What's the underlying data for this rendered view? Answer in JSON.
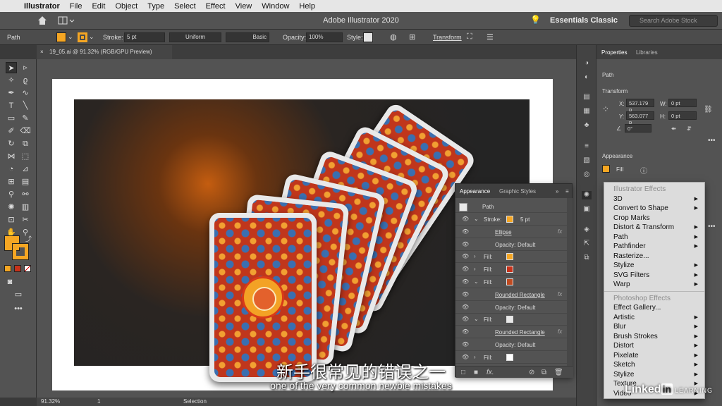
{
  "menubar": {
    "apple_icon": "apple-logo-icon",
    "app_name": "Illustrator",
    "items": [
      "File",
      "Edit",
      "Object",
      "Type",
      "Select",
      "Effect",
      "View",
      "Window",
      "Help"
    ]
  },
  "titlebar": {
    "title": "Adobe Illustrator 2020",
    "workspace": "Essentials Classic",
    "search_placeholder": "Search Adobe Stock"
  },
  "controlbar": {
    "selection_type": "Path",
    "fill_color": "#f5a623",
    "stroke_label": "Stroke:",
    "stroke_weight": "5 pt",
    "profile": "Uniform",
    "brush": "Basic",
    "opacity_label": "Opacity:",
    "opacity": "100%",
    "style_label": "Style:",
    "transform_label": "Transform"
  },
  "document": {
    "tab_title": "19_05.ai @ 91.32% (RGB/GPU Preview)"
  },
  "statusbar": {
    "zoom": "91.32%",
    "artboard": "1",
    "tool": "Selection"
  },
  "properties": {
    "tabs": [
      "Properties",
      "Libraries"
    ],
    "selection": "Path",
    "transform_title": "Transform",
    "x_label": "X:",
    "x": "537.179 p",
    "y_label": "Y:",
    "y": "563.077 p",
    "w_label": "W:",
    "w": "0 pt",
    "h_label": "H:",
    "h": "0 pt",
    "angle": "0°",
    "appearance_title": "Appearance",
    "fill_label": "Fill"
  },
  "appearance": {
    "tabs": [
      "Appearance",
      "Graphic Styles"
    ],
    "object": "Path",
    "rows": [
      {
        "label": "Stroke:",
        "value": "5 pt",
        "swatch": "#f5a623",
        "indent": 0,
        "twirl": "⌄"
      },
      {
        "label": "Ellipse",
        "indent": 1,
        "fx": true
      },
      {
        "label": "Opacity:",
        "value": "Default",
        "indent": 1
      },
      {
        "label": "Fill:",
        "swatch": "#f5a623",
        "indent": 0,
        "twirl": "›"
      },
      {
        "label": "Fill:",
        "swatch": "#c7321a",
        "indent": 0,
        "twirl": "›"
      },
      {
        "label": "Fill:",
        "swatch": "#c04a20",
        "indent": 0,
        "twirl": "⌄"
      },
      {
        "label": "Rounded Rectangle",
        "indent": 1,
        "fx": true
      },
      {
        "label": "Opacity:",
        "value": "Default",
        "indent": 1
      },
      {
        "label": "Fill:",
        "swatch": "#e8e8e8",
        "indent": 0,
        "twirl": "⌄"
      },
      {
        "label": "Rounded Rectangle",
        "indent": 1,
        "fx": true
      },
      {
        "label": "Opacity:",
        "value": "Default",
        "indent": 1
      },
      {
        "label": "Fill:",
        "swatch": "#ffffff",
        "indent": 0,
        "twirl": "›"
      }
    ],
    "fx_icon": "fx"
  },
  "effect_menu": {
    "illustrator_header": "Illustrator Effects",
    "illustrator_items": [
      {
        "label": "3D",
        "submenu": true
      },
      {
        "label": "Convert to Shape",
        "submenu": true
      },
      {
        "label": "Crop Marks",
        "submenu": false
      },
      {
        "label": "Distort & Transform",
        "submenu": true
      },
      {
        "label": "Path",
        "submenu": true
      },
      {
        "label": "Pathfinder",
        "submenu": true
      },
      {
        "label": "Rasterize...",
        "submenu": false
      },
      {
        "label": "Stylize",
        "submenu": true
      },
      {
        "label": "SVG Filters",
        "submenu": true
      },
      {
        "label": "Warp",
        "submenu": true
      }
    ],
    "photoshop_header": "Photoshop Effects",
    "photoshop_items": [
      {
        "label": "Effect Gallery...",
        "submenu": false
      },
      {
        "label": "Artistic",
        "submenu": true
      },
      {
        "label": "Blur",
        "submenu": true
      },
      {
        "label": "Brush Strokes",
        "submenu": true
      },
      {
        "label": "Distort",
        "submenu": true
      },
      {
        "label": "Pixelate",
        "submenu": true
      },
      {
        "label": "Sketch",
        "submenu": true
      },
      {
        "label": "Stylize",
        "submenu": true
      },
      {
        "label": "Texture",
        "submenu": true
      },
      {
        "label": "Video",
        "submenu": true
      }
    ]
  },
  "subtitles": {
    "chinese": "新手很常见的错误之一",
    "english": "one of the very common newbie mistakes"
  },
  "watermark": {
    "brand": "Linked",
    "in": "in",
    "learning": "LEARNING"
  },
  "colors": {
    "accent_fill": "#f5a623",
    "card_red": "#c0361c",
    "card_border": "#e9e9e9"
  }
}
